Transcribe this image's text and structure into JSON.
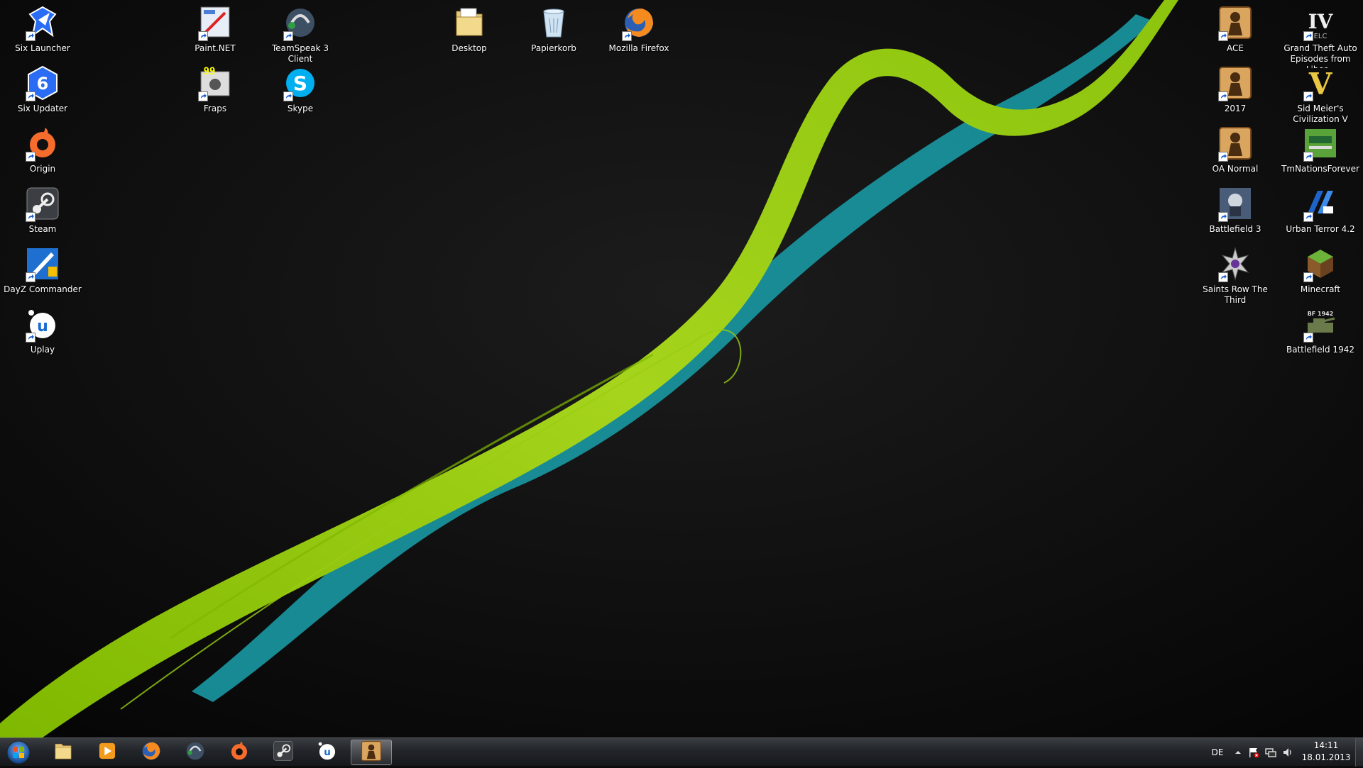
{
  "desktop": {
    "icons": [
      {
        "label": "Six Launcher",
        "icon": "six-launcher-icon"
      },
      {
        "label": "Six Updater",
        "icon": "six-updater-icon"
      },
      {
        "label": "Origin",
        "icon": "origin-icon"
      },
      {
        "label": "Steam",
        "icon": "steam-icon"
      },
      {
        "label": "DayZ Commander",
        "icon": "dayz-commander-icon"
      },
      {
        "label": "Uplay",
        "icon": "uplay-icon"
      },
      {
        "label": "Paint.NET",
        "icon": "paint-net-icon"
      },
      {
        "label": "Fraps",
        "icon": "fraps-icon"
      },
      {
        "label": "TeamSpeak 3 Client",
        "icon": "teamspeak-icon"
      },
      {
        "label": "Skype",
        "icon": "skype-icon"
      },
      {
        "label": "Desktop",
        "icon": "folder-icon"
      },
      {
        "label": "Papierkorb",
        "icon": "recycle-bin-icon"
      },
      {
        "label": "Mozilla Firefox",
        "icon": "firefox-icon"
      },
      {
        "label": "ACE",
        "icon": "soldier-game-icon"
      },
      {
        "label": "2017",
        "icon": "soldier-game-icon"
      },
      {
        "label": "OA Normal",
        "icon": "soldier-game-icon"
      },
      {
        "label": "Battlefield 3",
        "icon": "battlefield3-icon"
      },
      {
        "label": "Saints Row The Third",
        "icon": "saints-row-icon"
      },
      {
        "label": "Grand Theft Auto Episodes from Liber...",
        "icon": "gta-iv-icon"
      },
      {
        "label": "Sid Meier's Civilization V",
        "icon": "civilization-v-icon"
      },
      {
        "label": "TmNationsForever",
        "icon": "trackmania-icon"
      },
      {
        "label": "Urban Terror 4.2",
        "icon": "urban-terror-icon"
      },
      {
        "label": "Minecraft",
        "icon": "minecraft-icon"
      },
      {
        "label": "Battlefield 1942",
        "icon": "battlefield1942-icon"
      }
    ]
  },
  "taskbar": {
    "start_icon": "windows-start-icon",
    "pinned": [
      {
        "icon": "explorer-icon",
        "active": false
      },
      {
        "icon": "media-player-icon",
        "active": false
      },
      {
        "icon": "firefox-icon",
        "active": false
      },
      {
        "icon": "teamspeak-icon",
        "active": false
      },
      {
        "icon": "origin-icon",
        "active": false
      },
      {
        "icon": "steam-icon",
        "active": false
      },
      {
        "icon": "uplay-icon",
        "active": false
      },
      {
        "icon": "soldier-game-icon",
        "active": true
      }
    ],
    "tray": {
      "language": "DE",
      "icons": [
        "show-hidden-icons-arrow-icon",
        "action-center-flag-icon",
        "network-icon",
        "volume-icon"
      ],
      "time": "14:11",
      "date": "18.01.2013"
    }
  },
  "colors": {
    "wallpaper_bg": "#0b0b0b",
    "swoosh_green": "#9acd12",
    "swoosh_teal": "#1f9fa8"
  }
}
